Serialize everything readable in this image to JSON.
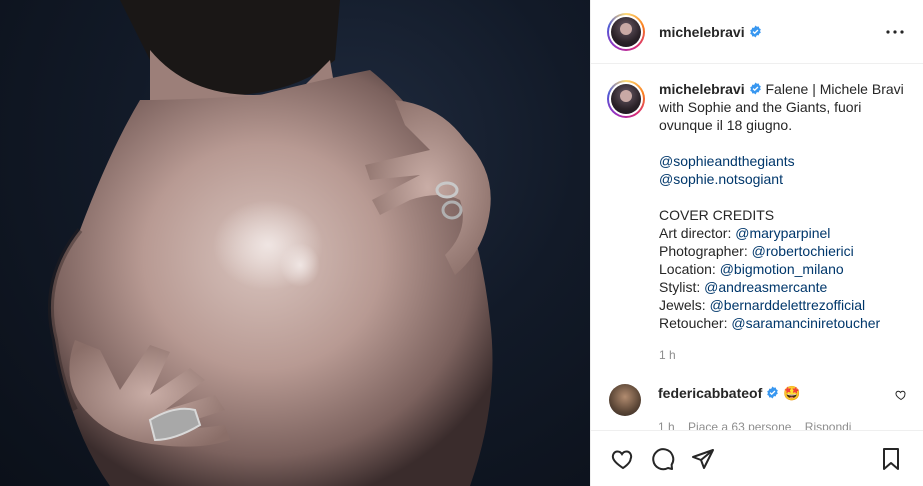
{
  "header": {
    "username": "michelebravi"
  },
  "caption": {
    "username": "michelebravi",
    "text_line1": "Falene | Michele Bravi",
    "text_line2": "with Sophie and the Giants, fuori",
    "text_line3": "ovunque il 18 giugno.",
    "mention1": "@sophieandthegiants",
    "mention2": "@sophie.notsogiant",
    "credits_title": "COVER CREDITS",
    "credits": [
      {
        "label": "Art director: ",
        "handle": "@maryparpinel"
      },
      {
        "label": "Photographer: ",
        "handle": "@robertochierici"
      },
      {
        "label": "Location: ",
        "handle": "@bigmotion_milano"
      },
      {
        "label": "Stylist: ",
        "handle": "@andreasmercante"
      },
      {
        "label": "Jewels: ",
        "handle": "@bernarddelettrezofficial"
      },
      {
        "label": "Retoucher: ",
        "handle": "@saramanciniretoucher"
      }
    ],
    "time": "1 h"
  },
  "comment": {
    "username": "federicabbateof",
    "emoji": "🤩",
    "time": "1 h",
    "likes": "Piace a 63 persone",
    "reply": "Rispondi"
  },
  "icons": {
    "verified": "verified-badge-icon",
    "more": "more-options-icon",
    "like": "heart-icon",
    "comment": "comment-icon",
    "share": "share-icon",
    "save": "bookmark-icon"
  },
  "colors": {
    "link": "#00376b",
    "verified": "#3897f0",
    "muted": "#8e8e8e",
    "text": "#262626"
  }
}
